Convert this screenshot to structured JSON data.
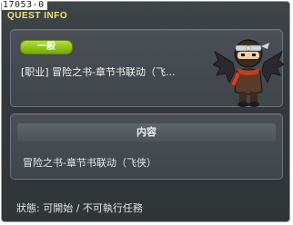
{
  "window": {
    "quest_id": "17053-0",
    "title": "QUEST INFO"
  },
  "quest": {
    "category": "一般",
    "name": "[职业] 冒险之书-章节书联动（飞..."
  },
  "details": {
    "header": "内容",
    "text": "冒险之书-章节书联动（飞侠）"
  },
  "status": {
    "text": "狀態: 可開始 / 不可執行任務"
  },
  "colors": {
    "title": "#f2e37a",
    "badge": "#8fc21a",
    "panel": "#43494d"
  },
  "icons": {
    "character": "ninja-character-icon"
  }
}
